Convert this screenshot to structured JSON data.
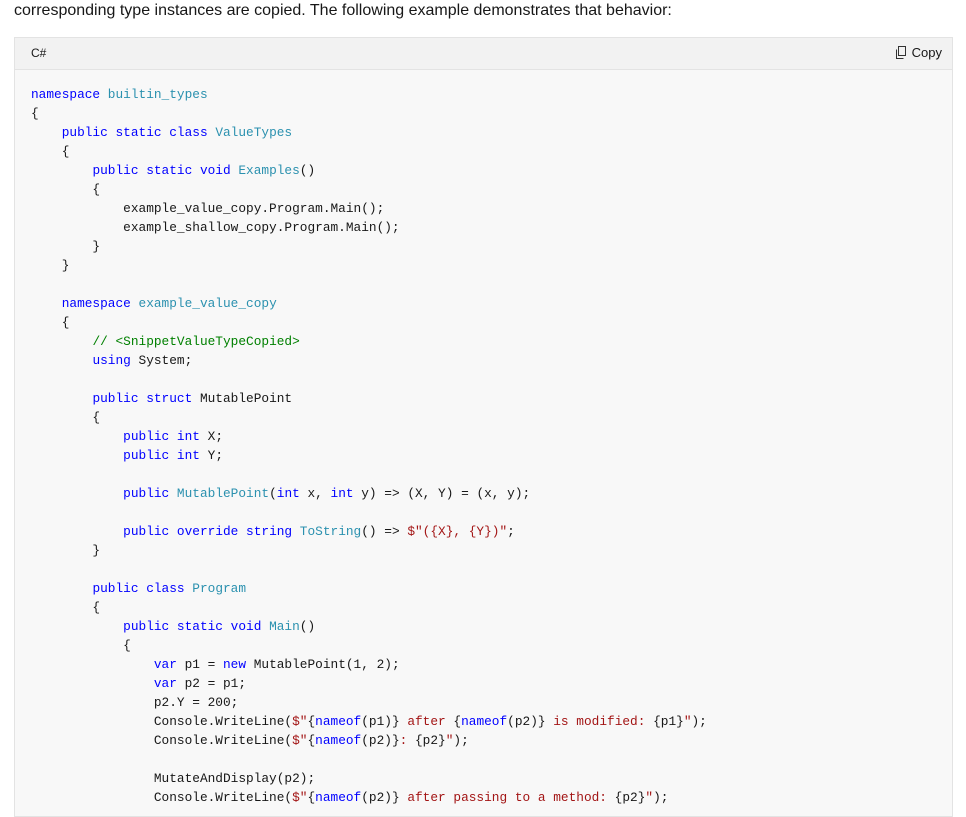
{
  "intro_text": "corresponding type instances are copied. The following example demonstrates that behavior:",
  "code_header": {
    "language": "C#",
    "copy_label": "Copy"
  },
  "code_lines": [
    [
      {
        "c": "kw",
        "t": "namespace "
      },
      {
        "c": "ty",
        "t": "builtin_types"
      }
    ],
    [
      {
        "c": "",
        "t": "{"
      }
    ],
    [
      {
        "c": "",
        "t": "    "
      },
      {
        "c": "kw",
        "t": "public static class "
      },
      {
        "c": "ty",
        "t": "ValueTypes"
      }
    ],
    [
      {
        "c": "",
        "t": "    {"
      }
    ],
    [
      {
        "c": "",
        "t": "        "
      },
      {
        "c": "kw",
        "t": "public static void "
      },
      {
        "c": "ty",
        "t": "Examples"
      },
      {
        "c": "",
        "t": "()"
      }
    ],
    [
      {
        "c": "",
        "t": "        {"
      }
    ],
    [
      {
        "c": "",
        "t": "            example_value_copy.Program.Main();"
      }
    ],
    [
      {
        "c": "",
        "t": "            example_shallow_copy.Program.Main();"
      }
    ],
    [
      {
        "c": "",
        "t": "        }"
      }
    ],
    [
      {
        "c": "",
        "t": "    }"
      }
    ],
    [
      {
        "c": "",
        "t": ""
      }
    ],
    [
      {
        "c": "",
        "t": "    "
      },
      {
        "c": "kw",
        "t": "namespace "
      },
      {
        "c": "ty",
        "t": "example_value_copy"
      }
    ],
    [
      {
        "c": "",
        "t": "    {"
      }
    ],
    [
      {
        "c": "",
        "t": "        "
      },
      {
        "c": "cm",
        "t": "// <SnippetValueTypeCopied>"
      }
    ],
    [
      {
        "c": "",
        "t": "        "
      },
      {
        "c": "kw",
        "t": "using "
      },
      {
        "c": "",
        "t": "System;"
      }
    ],
    [
      {
        "c": "",
        "t": ""
      }
    ],
    [
      {
        "c": "",
        "t": "        "
      },
      {
        "c": "kw",
        "t": "public struct "
      },
      {
        "c": "",
        "t": "MutablePoint"
      }
    ],
    [
      {
        "c": "",
        "t": "        {"
      }
    ],
    [
      {
        "c": "",
        "t": "            "
      },
      {
        "c": "kw",
        "t": "public int "
      },
      {
        "c": "",
        "t": "X;"
      }
    ],
    [
      {
        "c": "",
        "t": "            "
      },
      {
        "c": "kw",
        "t": "public int "
      },
      {
        "c": "",
        "t": "Y;"
      }
    ],
    [
      {
        "c": "",
        "t": ""
      }
    ],
    [
      {
        "c": "",
        "t": "            "
      },
      {
        "c": "kw",
        "t": "public "
      },
      {
        "c": "ty",
        "t": "MutablePoint"
      },
      {
        "c": "",
        "t": "("
      },
      {
        "c": "kw",
        "t": "int "
      },
      {
        "c": "",
        "t": "x, "
      },
      {
        "c": "kw",
        "t": "int "
      },
      {
        "c": "",
        "t": "y) => (X, Y) = (x, y);"
      }
    ],
    [
      {
        "c": "",
        "t": ""
      }
    ],
    [
      {
        "c": "",
        "t": "            "
      },
      {
        "c": "kw",
        "t": "public override string "
      },
      {
        "c": "ty",
        "t": "ToString"
      },
      {
        "c": "",
        "t": "() => "
      },
      {
        "c": "st",
        "t": "$\"({X}, {Y})\""
      },
      {
        "c": "",
        "t": ";"
      }
    ],
    [
      {
        "c": "",
        "t": "        }"
      }
    ],
    [
      {
        "c": "",
        "t": ""
      }
    ],
    [
      {
        "c": "",
        "t": "        "
      },
      {
        "c": "kw",
        "t": "public class "
      },
      {
        "c": "ty",
        "t": "Program"
      }
    ],
    [
      {
        "c": "",
        "t": "        {"
      }
    ],
    [
      {
        "c": "",
        "t": "            "
      },
      {
        "c": "kw",
        "t": "public static void "
      },
      {
        "c": "ty",
        "t": "Main"
      },
      {
        "c": "",
        "t": "()"
      }
    ],
    [
      {
        "c": "",
        "t": "            {"
      }
    ],
    [
      {
        "c": "",
        "t": "                "
      },
      {
        "c": "kw",
        "t": "var "
      },
      {
        "c": "",
        "t": "p1 = "
      },
      {
        "c": "kw",
        "t": "new "
      },
      {
        "c": "",
        "t": "MutablePoint(1, 2);"
      }
    ],
    [
      {
        "c": "",
        "t": "                "
      },
      {
        "c": "kw",
        "t": "var "
      },
      {
        "c": "",
        "t": "p2 = p1;"
      }
    ],
    [
      {
        "c": "",
        "t": "                p2.Y = 200;"
      }
    ],
    [
      {
        "c": "",
        "t": "                Console.WriteLine("
      },
      {
        "c": "st",
        "t": "$\""
      },
      {
        "c": "",
        "t": "{"
      },
      {
        "c": "kw",
        "t": "nameof"
      },
      {
        "c": "",
        "t": "(p1)}"
      },
      {
        "c": "st",
        "t": " after "
      },
      {
        "c": "",
        "t": "{"
      },
      {
        "c": "kw",
        "t": "nameof"
      },
      {
        "c": "",
        "t": "(p2)}"
      },
      {
        "c": "st",
        "t": " is modified: "
      },
      {
        "c": "",
        "t": "{p1}"
      },
      {
        "c": "st",
        "t": "\""
      },
      {
        "c": "",
        "t": ");"
      }
    ],
    [
      {
        "c": "",
        "t": "                Console.WriteLine("
      },
      {
        "c": "st",
        "t": "$\""
      },
      {
        "c": "",
        "t": "{"
      },
      {
        "c": "kw",
        "t": "nameof"
      },
      {
        "c": "",
        "t": "(p2)}"
      },
      {
        "c": "st",
        "t": ": "
      },
      {
        "c": "",
        "t": "{p2}"
      },
      {
        "c": "st",
        "t": "\""
      },
      {
        "c": "",
        "t": ");"
      }
    ],
    [
      {
        "c": "",
        "t": ""
      }
    ],
    [
      {
        "c": "",
        "t": "                MutateAndDisplay(p2);"
      }
    ],
    [
      {
        "c": "",
        "t": "                Console.WriteLine("
      },
      {
        "c": "st",
        "t": "$\""
      },
      {
        "c": "",
        "t": "{"
      },
      {
        "c": "kw",
        "t": "nameof"
      },
      {
        "c": "",
        "t": "(p2)}"
      },
      {
        "c": "st",
        "t": " after passing to a method: "
      },
      {
        "c": "",
        "t": "{p2}"
      },
      {
        "c": "st",
        "t": "\""
      },
      {
        "c": "",
        "t": ");"
      }
    ]
  ]
}
